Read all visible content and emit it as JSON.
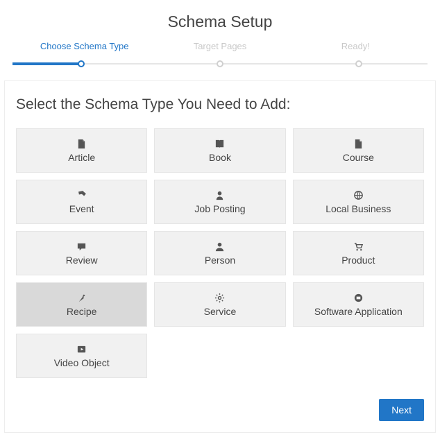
{
  "title": "Schema Setup",
  "steps": [
    {
      "label": "Choose Schema Type",
      "active": true
    },
    {
      "label": "Target Pages",
      "active": false
    },
    {
      "label": "Ready!",
      "active": false
    }
  ],
  "subheading": "Select the Schema Type You Need to Add:",
  "schema_types": [
    {
      "label": "Article",
      "icon": "file-icon",
      "selected": false
    },
    {
      "label": "Book",
      "icon": "book-icon",
      "selected": false
    },
    {
      "label": "Course",
      "icon": "page-icon",
      "selected": false
    },
    {
      "label": "Event",
      "icon": "ticket-icon",
      "selected": false
    },
    {
      "label": "Job Posting",
      "icon": "user-plus-icon",
      "selected": false
    },
    {
      "label": "Local Business",
      "icon": "globe-icon",
      "selected": false
    },
    {
      "label": "Review",
      "icon": "comment-icon",
      "selected": false
    },
    {
      "label": "Person",
      "icon": "user-icon",
      "selected": false
    },
    {
      "label": "Product",
      "icon": "cart-icon",
      "selected": false
    },
    {
      "label": "Recipe",
      "icon": "carrot-icon",
      "selected": true
    },
    {
      "label": "Service",
      "icon": "gear-icon",
      "selected": false
    },
    {
      "label": "Software Application",
      "icon": "desktop-icon",
      "selected": false
    },
    {
      "label": "Video Object",
      "icon": "play-icon",
      "selected": false
    }
  ],
  "next_label": "Next"
}
